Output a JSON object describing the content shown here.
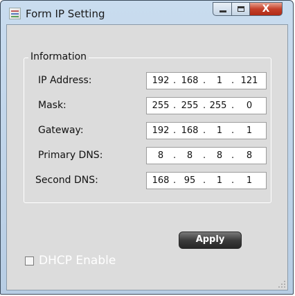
{
  "window": {
    "title": "Form IP Setting",
    "close_label": "X"
  },
  "group": {
    "title": "Information"
  },
  "fields": [
    {
      "label": "IP Address:",
      "octets": [
        "192",
        "168",
        "1",
        "121"
      ]
    },
    {
      "label": "Mask:",
      "octets": [
        "255",
        "255",
        "255",
        "0"
      ]
    },
    {
      "label": "Gateway:",
      "octets": [
        "192",
        "168",
        "1",
        "1"
      ]
    },
    {
      "label": "Primary DNS:",
      "octets": [
        "8",
        "8",
        "8",
        "8"
      ]
    },
    {
      "label": "Second DNS:",
      "octets": [
        "168",
        "95",
        "1",
        "1"
      ]
    }
  ],
  "apply_label": "Apply",
  "dhcp": {
    "label": "DHCP Enable",
    "checked": false
  }
}
